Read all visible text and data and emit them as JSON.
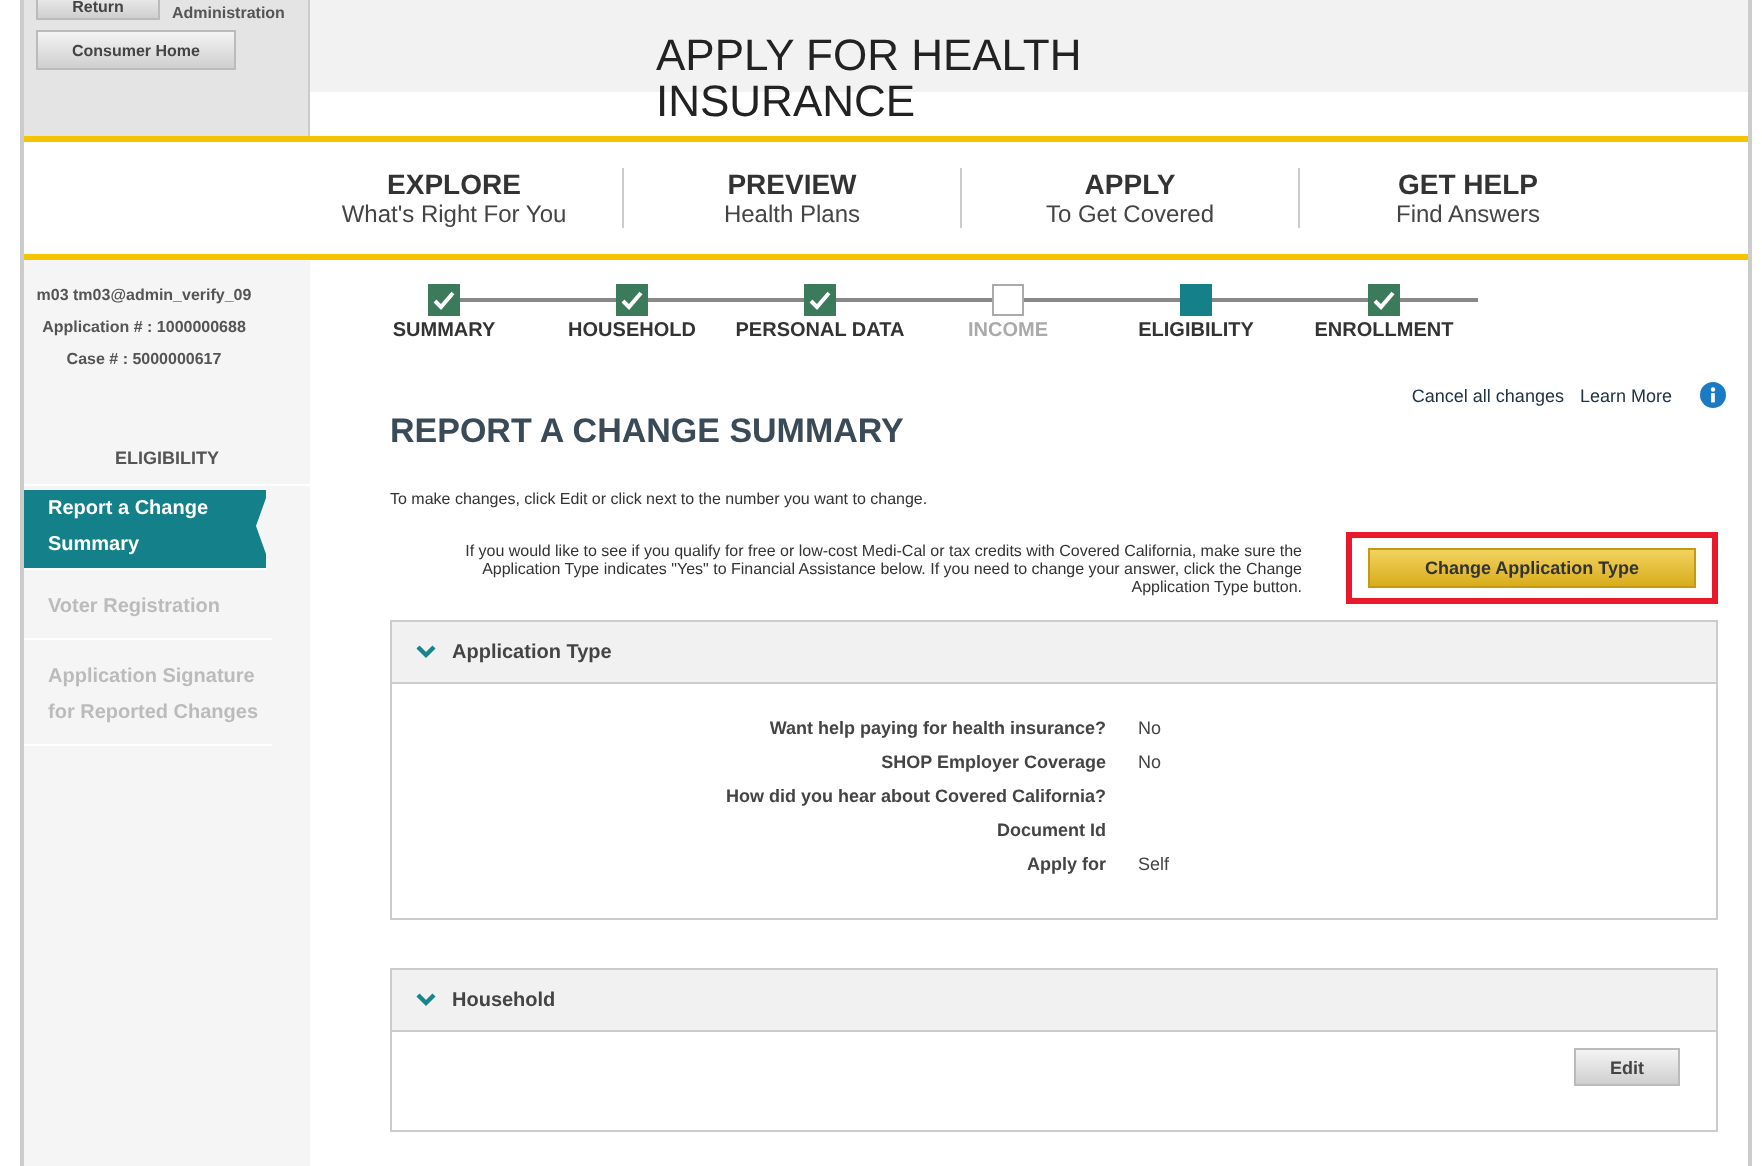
{
  "header": {
    "buttons": [
      {
        "label": "Return"
      },
      {
        "label": "Consumer Home"
      }
    ],
    "admin_label": "Administration",
    "title": "APPLY FOR HEALTH INSURANCE"
  },
  "nav": [
    {
      "title": "EXPLORE",
      "subtitle": "What's Right For You"
    },
    {
      "title": "PREVIEW",
      "subtitle": "Health Plans"
    },
    {
      "title": "APPLY",
      "subtitle": "To Get Covered"
    },
    {
      "title": "GET HELP",
      "subtitle": "Find Answers"
    }
  ],
  "user": {
    "lines": [
      "m03 tm03@admin_verify_09",
      "Application # : 1000000688",
      "Case # : 5000000617"
    ]
  },
  "sidebar": {
    "heading": "ELIGIBILITY",
    "items": [
      {
        "label": "Report a Change Summary",
        "selected": true,
        "disabled": false
      },
      {
        "label": "Voter Registration",
        "selected": false,
        "disabled": true
      },
      {
        "label": "Application Signature for Reported Changes",
        "selected": false,
        "disabled": true
      }
    ]
  },
  "steps": [
    {
      "label": "SUMMARY",
      "kind": "complete"
    },
    {
      "label": "HOUSEHOLD",
      "kind": "complete"
    },
    {
      "label": "PERSONAL DATA",
      "kind": "complete"
    },
    {
      "label": "INCOME",
      "kind": "incomplete"
    },
    {
      "label": "ELIGIBILITY",
      "kind": "current"
    },
    {
      "label": "ENROLLMENT",
      "kind": "complete"
    }
  ],
  "links": [
    "Cancel all changes",
    "Learn More"
  ],
  "page_title": "REPORT A CHANGE SUMMARY",
  "instructions": "To make changes, click Edit or click next to the number you want to change.",
  "notice": {
    "text": "If you would like to see if you qualify for free or low-cost Medi-Cal or tax credits with Covered California, make sure the Application Type indicates \"Yes\" to Financial Assistance below. If you need to change your answer, click the Change Application Type button.",
    "button": "Change Application Type",
    "highlighted": true
  },
  "sections": [
    {
      "title": "Application Type",
      "expanded": true,
      "rows": [
        {
          "label": "Want help paying for health insurance?",
          "value": "No"
        },
        {
          "label": "SHOP Employer Coverage",
          "value": "No"
        },
        {
          "label": "How did you hear about Covered California?"
        },
        {
          "label": "Document Id"
        },
        {
          "label": "Apply for",
          "value": "Self"
        }
      ]
    },
    {
      "title": "Household",
      "expanded": true,
      "button": "Edit"
    }
  ]
}
